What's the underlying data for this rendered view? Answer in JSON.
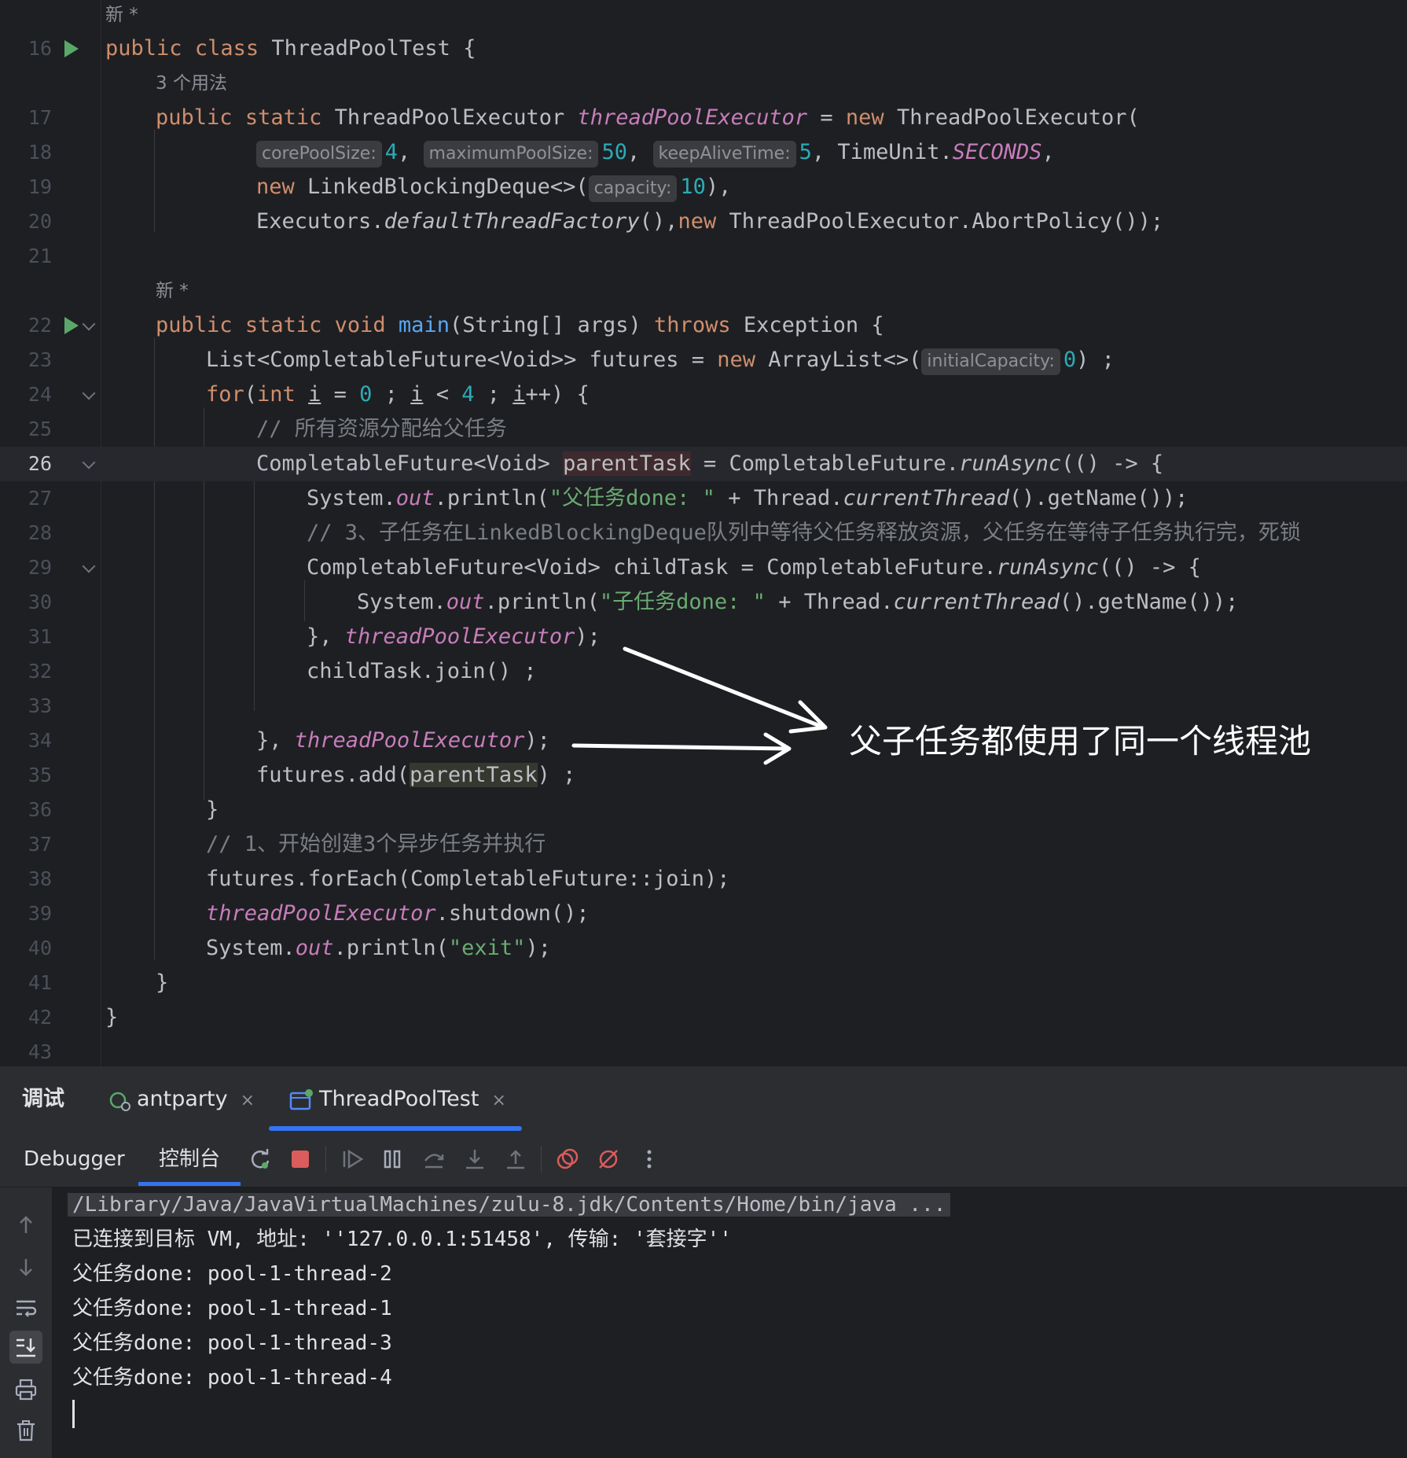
{
  "editor": {
    "lens_new": "新 *",
    "lens_usages": "3 个用法",
    "lines": [
      {
        "n": "16"
      },
      {
        "n": "17"
      },
      {
        "n": "18"
      },
      {
        "n": "19"
      },
      {
        "n": "20"
      },
      {
        "n": "21"
      },
      {
        "n": "22"
      },
      {
        "n": "23"
      },
      {
        "n": "24"
      },
      {
        "n": "25"
      },
      {
        "n": "26"
      },
      {
        "n": "27"
      },
      {
        "n": "28"
      },
      {
        "n": "29"
      },
      {
        "n": "30"
      },
      {
        "n": "31"
      },
      {
        "n": "32"
      },
      {
        "n": "33"
      },
      {
        "n": "34"
      },
      {
        "n": "35"
      },
      {
        "n": "36"
      },
      {
        "n": "37"
      },
      {
        "n": "38"
      },
      {
        "n": "39"
      },
      {
        "n": "40"
      },
      {
        "n": "41"
      },
      {
        "n": "42"
      },
      {
        "n": "43"
      }
    ],
    "t": {
      "public": "public",
      "class": "class",
      "static": "static",
      "new": "new",
      "void": "void",
      "throws": "throws",
      "for": "for",
      "int": "int",
      "class_name": "ThreadPoolTest",
      "open_brace": " {",
      "close_brace": "}",
      "type_tpe": "ThreadPoolExecutor",
      "field_tpe": "threadPoolExecutor",
      "assign_new": " = ",
      "ctor_tpe": "ThreadPoolExecutor(",
      "hint_core": "corePoolSize:",
      "val_core": "4",
      "hint_max": "maximumPoolSize:",
      "val_max": "50",
      "hint_keep": "keepAliveTime:",
      "val_keep": "5",
      "timeunit": "TimeUnit.",
      "seconds": "SECONDS",
      "comma": ",",
      "lbd": "LinkedBlockingDeque<>(",
      "hint_cap": "capacity:",
      "val_cap": "10",
      "close_paren_comma": "),",
      "executors": "Executors.",
      "default_tf": "defaultThreadFactory",
      "tf_tail": "(),",
      "abort": "ThreadPoolExecutor.AbortPolicy());",
      "main": "main",
      "main_sig": "(String[] args) ",
      "exception": "Exception {",
      "l23a": "List<CompletableFuture<Void>> futures = ",
      "arraylist": "ArrayList<>(",
      "hint_init": "initialCapacity:",
      "val_init": "0",
      "l23_tail": ") ;",
      "l24_open": "(",
      "l24_i": "i",
      "l24_eq": " = ",
      "zero": "0",
      "l24_sc1": " ; ",
      "l24_lt": " < ",
      "four": "4",
      "l24_sc2": " ; ",
      "l24_pp": "++) {",
      "c25": "// 所有资源分配给父任务",
      "cf_void": "CompletableFuture<Void> ",
      "parent_task": "parentTask",
      "cf_eq": " = CompletableFuture.",
      "run_async": "runAsync",
      "lambda_open": "(() -> {",
      "sys": "System.",
      "out": "out",
      "println_open": ".println(",
      "str_parent": "\"父任务done: \"",
      "plus_thread": " + Thread.",
      "current_thread": "currentThread",
      "get_name": "().getName());",
      "c28": "// 3、子任务在LinkedBlockingDeque队列中等待父任务释放资源，父任务在等待子任务执行完，死锁",
      "child_decl": "CompletableFuture<Void> childTask = CompletableFuture.",
      "str_child": "\"子任务done: \"",
      "close_lambda": "}, ",
      "close_call": ");",
      "child_join": "childTask.join() ;",
      "futures_add": "futures.add(",
      "add_tail": ") ;",
      "c37": "// 1、开始创建3个异步任务并执行",
      "foreach": "futures.forEach(CompletableFuture::join);",
      "shutdown": ".shutdown();",
      "str_exit": "\"exit\""
    }
  },
  "annotation": {
    "text": "父子任务都使用了同一个线程池"
  },
  "tabs": {
    "title": "调试",
    "items": [
      {
        "label": "antparty",
        "close": "×"
      },
      {
        "label": "ThreadPoolTest",
        "close": "×"
      }
    ]
  },
  "toolbar": {
    "debugger": "Debugger",
    "console": "控制台"
  },
  "console": {
    "lines": [
      "/Library/Java/JavaVirtualMachines/zulu-8.jdk/Contents/Home/bin/java ...",
      "已连接到目标 VM, 地址: ''127.0.0.1:51458', 传输: '套接字''",
      "父任务done: pool-1-thread-2",
      "父任务done: pool-1-thread-1",
      "父任务done: pool-1-thread-3",
      "父任务done: pool-1-thread-4"
    ]
  },
  "colors": {
    "background": "#1e1f22",
    "keyword": "#cf8e6d",
    "field": "#c77dbb",
    "function": "#56a8f5",
    "number": "#2aacb8",
    "string": "#6aab73",
    "comment": "#7a7e85",
    "accent": "#3574f0",
    "run": "#59a869"
  }
}
